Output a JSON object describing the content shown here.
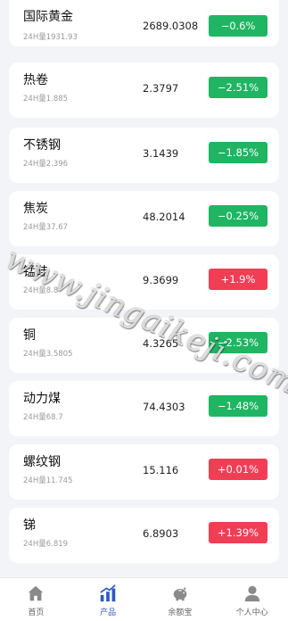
{
  "products": [
    {
      "name": "国际黄金",
      "volume": "24H量1931.93",
      "price": "2689.0308",
      "change": "−0.6%",
      "direction": "down"
    },
    {
      "name": "热卷",
      "volume": "24H量1.885",
      "price": "2.3797",
      "change": "−2.51%",
      "direction": "down"
    },
    {
      "name": "不锈钢",
      "volume": "24H量2.396",
      "price": "3.1439",
      "change": "−1.85%",
      "direction": "down"
    },
    {
      "name": "焦炭",
      "volume": "24H量37.67",
      "price": "48.2014",
      "change": "−0.25%",
      "direction": "down"
    },
    {
      "name": "锰硅",
      "volume": "24H量8.8",
      "price": "9.3699",
      "change": "+1.9%",
      "direction": "up"
    },
    {
      "name": "铜",
      "volume": "24H量3.5805",
      "price": "4.3265",
      "change": "−2.53%",
      "direction": "down"
    },
    {
      "name": "动力煤",
      "volume": "24H量68.7",
      "price": "74.4303",
      "change": "−1.48%",
      "direction": "down"
    },
    {
      "name": "螺纹钢",
      "volume": "24H量11.745",
      "price": "15.116",
      "change": "+0.01%",
      "direction": "up"
    },
    {
      "name": "锑",
      "volume": "24H量6.819",
      "price": "6.8903",
      "change": "+1.39%",
      "direction": "up"
    }
  ],
  "watermark": "www.jingaikeji.com",
  "tabbar": {
    "items": [
      {
        "label": "首页",
        "icon": "home-icon"
      },
      {
        "label": "产品",
        "icon": "bar-chart-icon",
        "active": true
      },
      {
        "label": "余额宝",
        "icon": "piggy-bank-icon"
      },
      {
        "label": "个人中心",
        "icon": "user-icon"
      }
    ]
  },
  "colors": {
    "down": "#1fb562",
    "up": "#f13e55",
    "active_tab": "#2d56c8",
    "inactive_icon": "#8a8a8a"
  }
}
